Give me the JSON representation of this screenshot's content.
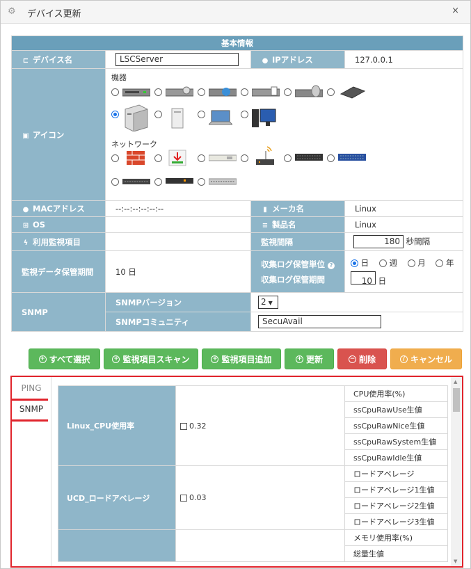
{
  "dialog": {
    "title": "デバイス更新",
    "close": "×"
  },
  "info": {
    "header": "基本情報",
    "device_name_label": "デバイス名",
    "device_name_value": "LSCServer",
    "ip_label": "IPアドレス",
    "ip_value": "127.0.0.1",
    "icon_label": "アイコン",
    "group_equipment": "機器",
    "group_network": "ネットワーク",
    "mac_label": "MACアドレス",
    "mac_value": "--:--:--:--:--:--",
    "maker_label": "メーカ名",
    "maker_value": "Linux",
    "os_label": "OS",
    "os_value": "",
    "product_label": "製品名",
    "product_value": "Linux",
    "monitor_items_label": "利用監視項目",
    "interval_label": "監視間隔",
    "interval_value": "180",
    "interval_unit": "秒間隔",
    "retention_label": "監視データ保管期間",
    "retention_value": "10 日",
    "log_unit_label": "収集ログ保管単位",
    "log_period_label": "収集ログ保管期間",
    "log_unit_options": [
      "日",
      "週",
      "月",
      "年"
    ],
    "log_unit_selected": "日",
    "log_period_value": "10",
    "log_period_unit": "日",
    "snmp_label": "SNMP",
    "snmp_version_label": "SNMPバージョン",
    "snmp_version_value": "2",
    "snmp_community_label": "SNMPコミュニティ",
    "snmp_community_value": "SecuAvail"
  },
  "buttons": {
    "select_all": "すべて選択",
    "scan": "監視項目スキャン",
    "add": "監視項目追加",
    "update": "更新",
    "delete": "削除",
    "cancel": "キャンセル"
  },
  "tabs": [
    "PING",
    "SNMP"
  ],
  "active_tab": "SNMP",
  "monitor_groups": [
    {
      "name": "Linux_CPU使用率",
      "value": "0.32",
      "items": [
        "CPU使用率(%)",
        "ssCpuRawUse生値",
        "ssCpuRawNice生値",
        "ssCpuRawSystem生値",
        "ssCpuRawIdle生値"
      ]
    },
    {
      "name": "UCD_ロードアベレージ",
      "value": "0.03",
      "items": [
        "ロードアベレージ",
        "ロードアベレージ1生値",
        "ロードアベレージ2生値",
        "ロードアベレージ3生値"
      ]
    },
    {
      "name": "",
      "value": "",
      "items": [
        "メモリ使用率(%)",
        "総量生値"
      ]
    }
  ],
  "colors": {
    "label_bg": "#8fb6c9",
    "header_bg": "#6a9fba",
    "green": "#5cb85c",
    "red": "#d9534f",
    "orange": "#f0ad4e",
    "highlight": "#e0242c"
  }
}
